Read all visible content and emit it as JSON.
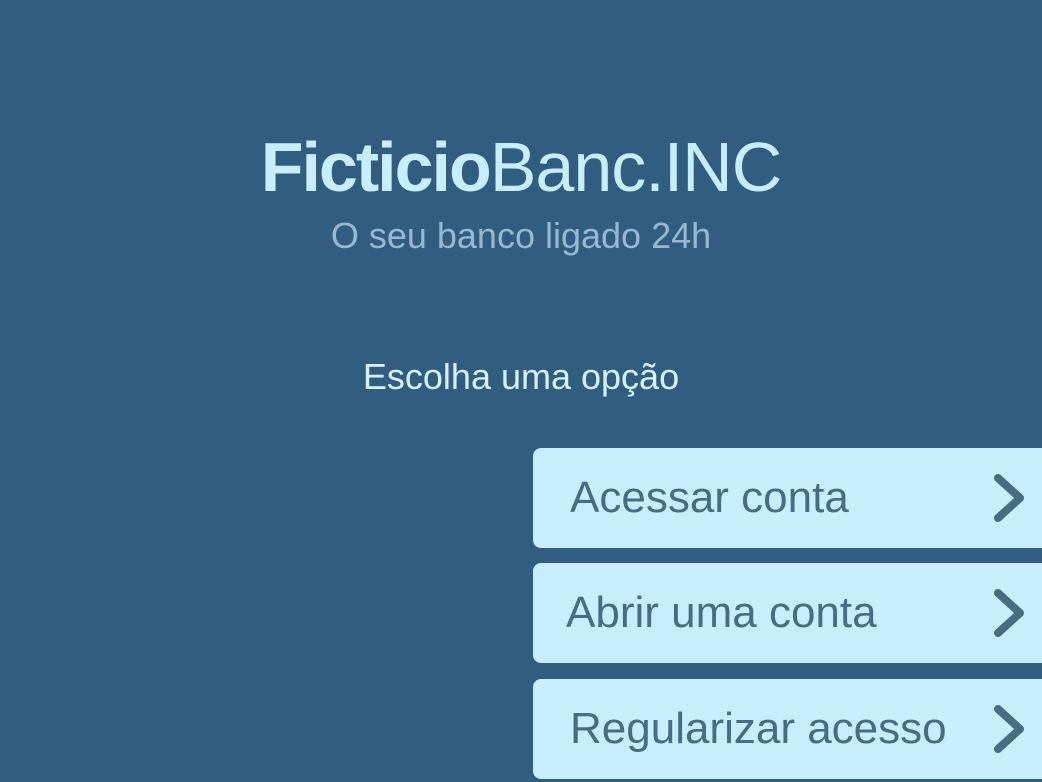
{
  "brand": {
    "name_bold": "Ficticio",
    "name_light": "Banc.INC",
    "tagline": "O seu banco ligado 24h"
  },
  "prompt": "Escolha uma opção",
  "options": [
    {
      "label": "Acessar conta",
      "icon": "chevron-right-icon"
    },
    {
      "label": "Abrir uma conta",
      "icon": "chevron-right-icon"
    },
    {
      "label": "Regularizar acesso",
      "icon": "chevron-right-icon"
    }
  ],
  "colors": {
    "background": "#305d80",
    "brand": "#c8eefe",
    "button_bg": "#c8eefe",
    "button_text": "#486d83",
    "tagline": "#96b9cf"
  }
}
